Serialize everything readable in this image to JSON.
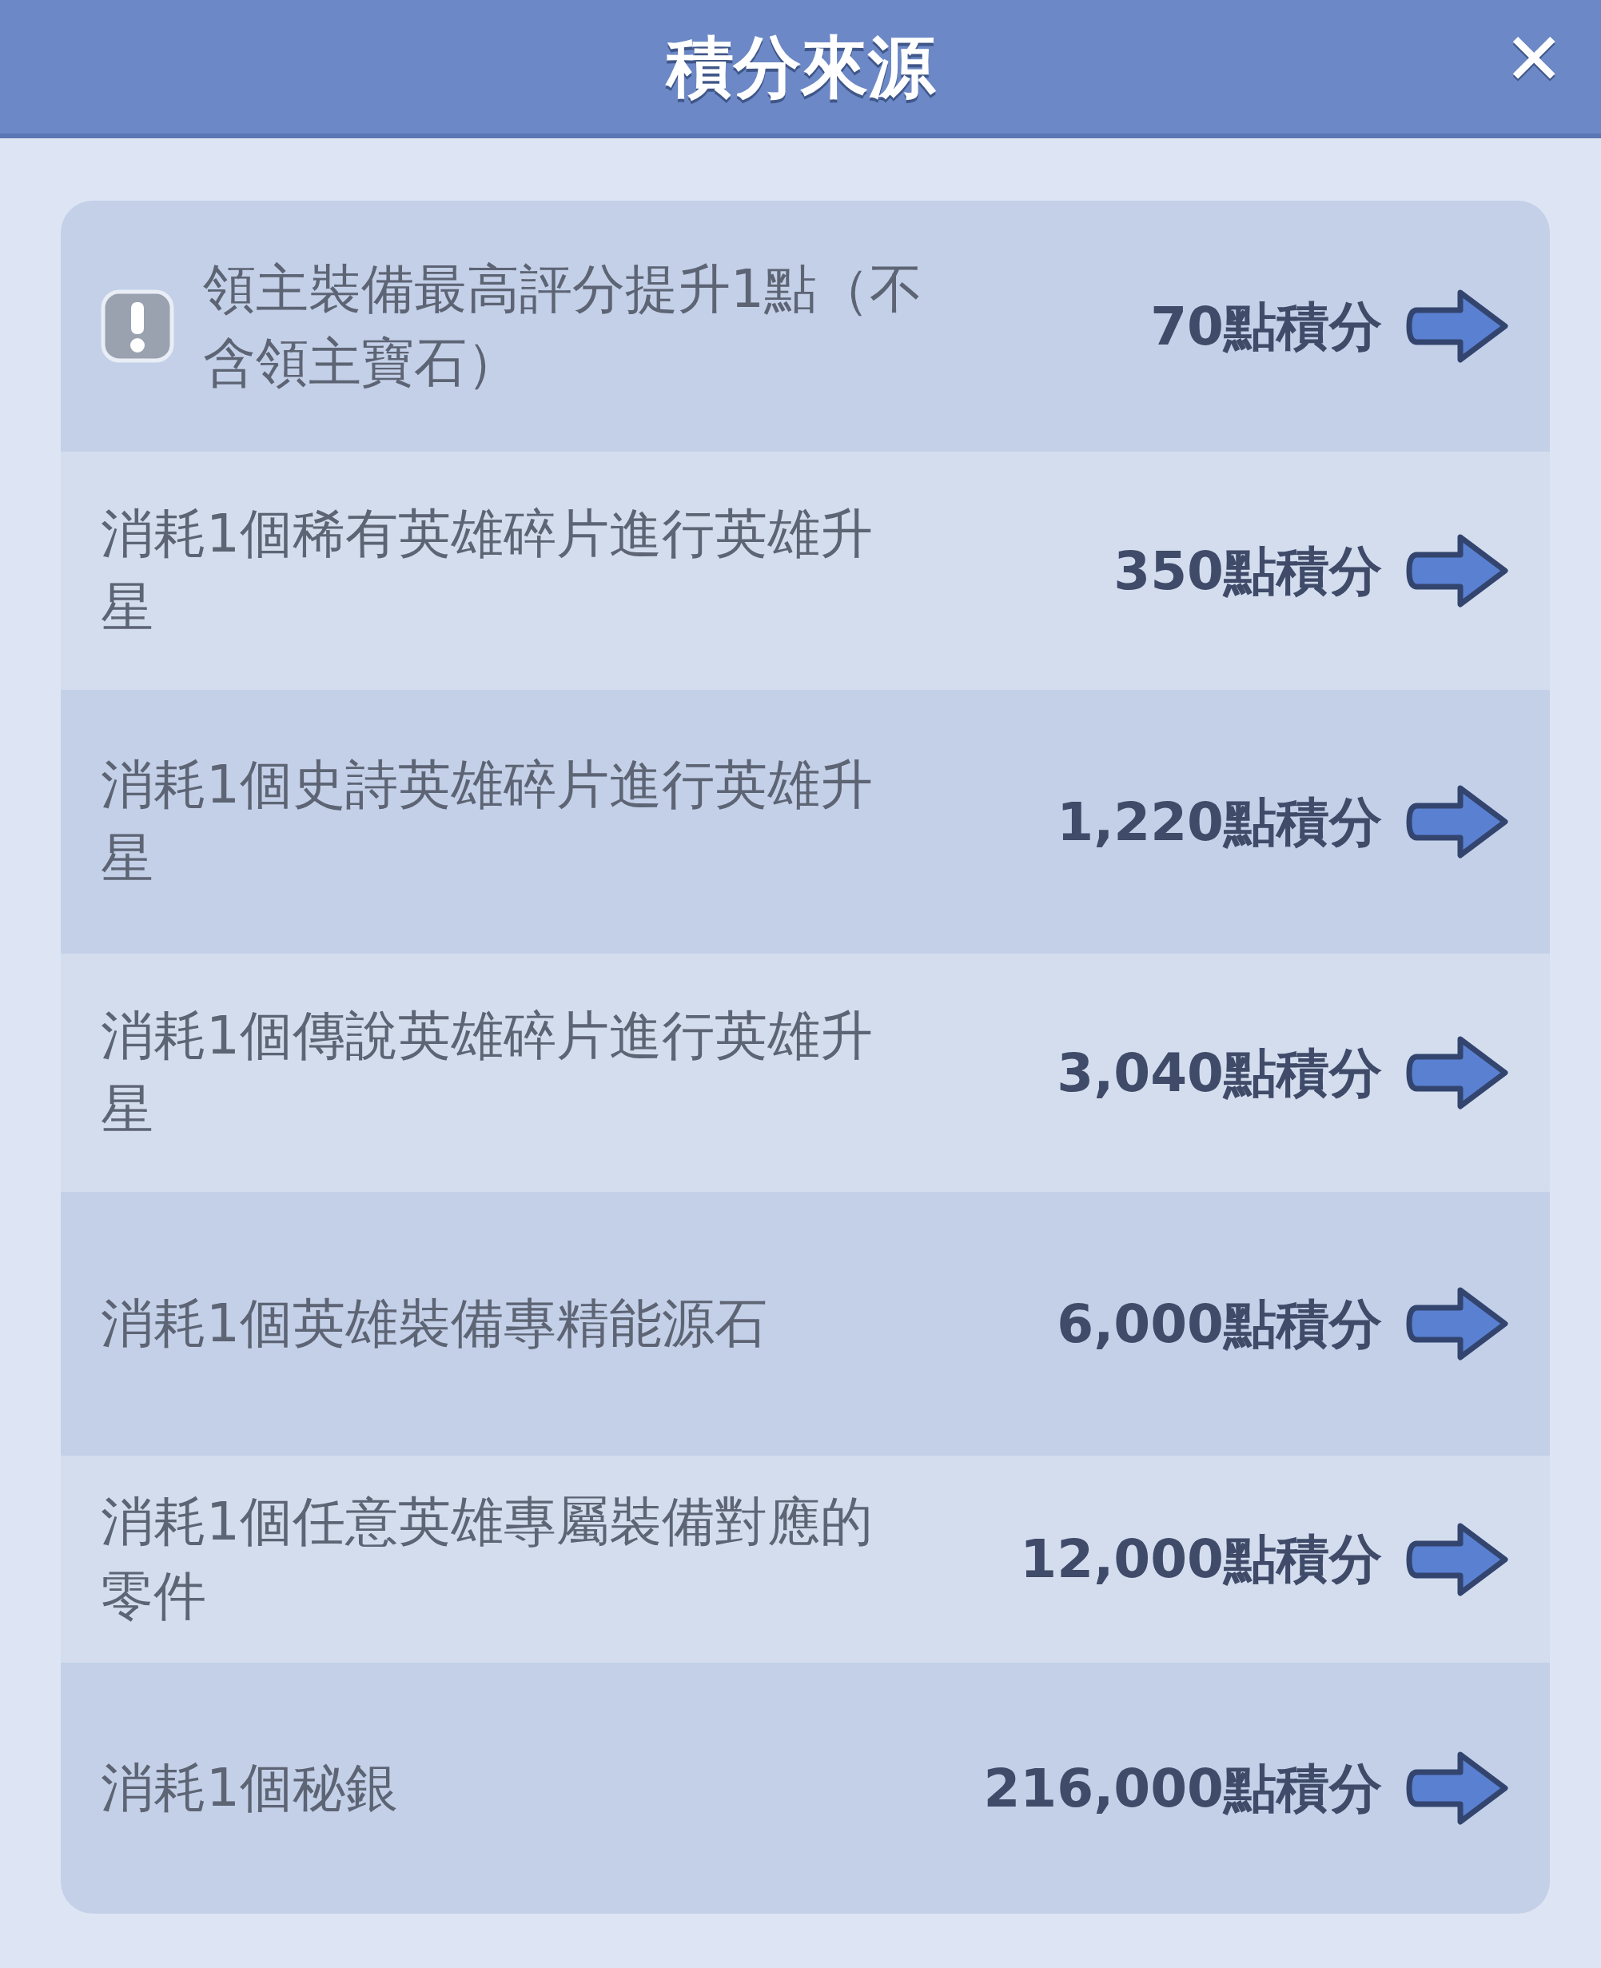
{
  "window": {
    "title": "積分來源",
    "close": "✕"
  },
  "rows": [
    {
      "kind": "notice",
      "text": "領主裝備最高評分提升1點（不含領主寶石）",
      "points": "70點積分"
    },
    {
      "kind": "plain",
      "text": "消耗1個稀有英雄碎片進行英雄升星",
      "points": "350點積分"
    },
    {
      "kind": "plain",
      "text": "消耗1個史詩英雄碎片進行英雄升星",
      "points": "1,220點積分"
    },
    {
      "kind": "plain",
      "text": "消耗1個傳說英雄碎片進行英雄升星",
      "points": "3,040點積分"
    },
    {
      "kind": "plain",
      "text": "消耗1個英雄裝備專精能源石",
      "points": "6,000點積分"
    },
    {
      "kind": "plain",
      "text": "消耗1個任意英雄專屬裝備對應的零件",
      "points": "12,000點積分"
    },
    {
      "kind": "plain",
      "text": "消耗1個秘銀",
      "points": "216,000點積分"
    }
  ]
}
